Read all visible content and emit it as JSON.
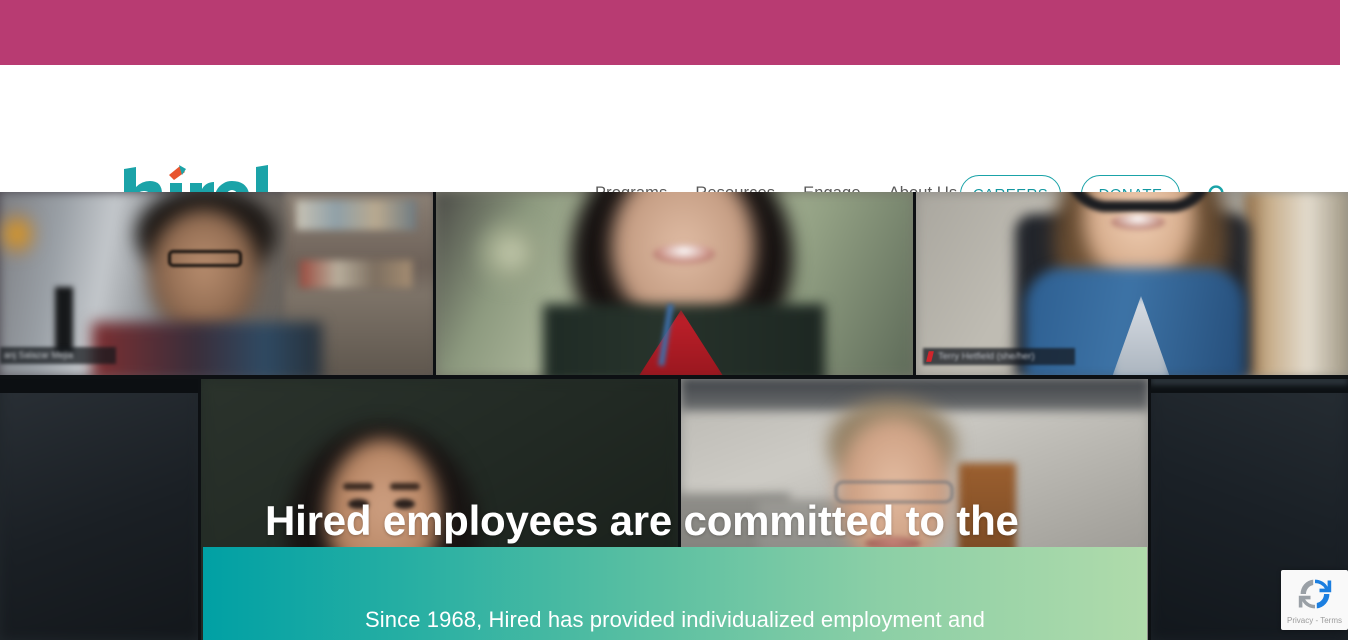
{
  "top_bar": {
    "color": "#b83b72"
  },
  "header": {
    "logo": {
      "text": "hired",
      "color": "#1ba3a8",
      "accent_color": "#e8552f",
      "accent_icon": "chevron-accent-icon"
    },
    "nav": [
      {
        "label": "Programs"
      },
      {
        "label": "Resources"
      },
      {
        "label": "Engage"
      },
      {
        "label": "About Us"
      }
    ],
    "buttons": [
      {
        "label": "CAREERS",
        "style": "outline-pill",
        "color": "#1397a0"
      },
      {
        "label": "DONATE",
        "style": "outline-pill",
        "color": "#1397a0"
      }
    ],
    "search": {
      "icon": "search-icon",
      "color": "#1aa3a8"
    }
  },
  "hero": {
    "headline": "Hired employees are committed to the organization, the participants and each other.",
    "video_tiles": [
      {
        "id": "tile-a",
        "participant_label": "anj Salazar Mejia"
      },
      {
        "id": "tile-b",
        "participant_label": ""
      },
      {
        "id": "tile-c",
        "participant_label": "Terry Hetfield (she/her)"
      },
      {
        "id": "tile-d",
        "participant_label": ""
      },
      {
        "id": "tile-e",
        "participant_label": ""
      },
      {
        "id": "tile-f",
        "participant_label": ""
      },
      {
        "id": "tile-g",
        "participant_label": ""
      }
    ]
  },
  "gradient_panel": {
    "text": "Since 1968, Hired has provided individualized employment and",
    "gradient_from": "#00a0a4",
    "gradient_to": "#b0dbab"
  },
  "recaptcha": {
    "label": "Privacy - Terms",
    "icon": "recaptcha-icon"
  }
}
